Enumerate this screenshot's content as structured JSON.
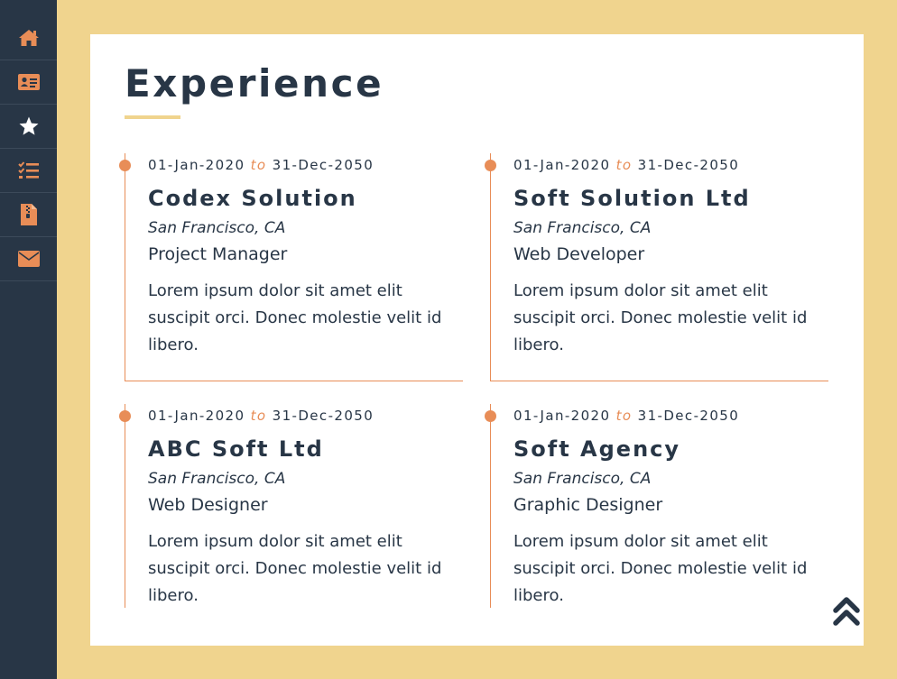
{
  "colors": {
    "background": "#f0d48e",
    "sidebar": "#283646",
    "accent": "#e88d57",
    "text": "#283646"
  },
  "sidebar": {
    "items": [
      {
        "icon": "home-icon"
      },
      {
        "icon": "id-card-icon"
      },
      {
        "icon": "star-icon"
      },
      {
        "icon": "checklist-icon"
      },
      {
        "icon": "file-zip-icon"
      },
      {
        "icon": "envelope-icon"
      }
    ]
  },
  "experience": {
    "title": "Experience",
    "entries": [
      {
        "date_from": "01-Jan-2020",
        "date_to_word": "to",
        "date_to": "31-Dec-2050",
        "company": "Codex Solution",
        "location": "San Francisco, CA",
        "role": "Project Manager",
        "description": "Lorem ipsum dolor sit amet elit suscipit orci. Donec molestie velit id libero."
      },
      {
        "date_from": "01-Jan-2020",
        "date_to_word": "to",
        "date_to": "31-Dec-2050",
        "company": "Soft Solution Ltd",
        "location": "San Francisco, CA",
        "role": "Web Developer",
        "description": "Lorem ipsum dolor sit amet elit suscipit orci. Donec molestie velit id libero."
      },
      {
        "date_from": "01-Jan-2020",
        "date_to_word": "to",
        "date_to": "31-Dec-2050",
        "company": "ABC Soft Ltd",
        "location": "San Francisco, CA",
        "role": "Web Designer",
        "description": "Lorem ipsum dolor sit amet elit suscipit orci. Donec molestie velit id libero."
      },
      {
        "date_from": "01-Jan-2020",
        "date_to_word": "to",
        "date_to": "31-Dec-2050",
        "company": "Soft Agency",
        "location": "San Francisco, CA",
        "role": "Graphic Designer",
        "description": "Lorem ipsum dolor sit amet elit suscipit orci. Donec molestie velit id libero."
      }
    ]
  },
  "scroll_top": {
    "icon": "double-chevron-up-icon"
  }
}
